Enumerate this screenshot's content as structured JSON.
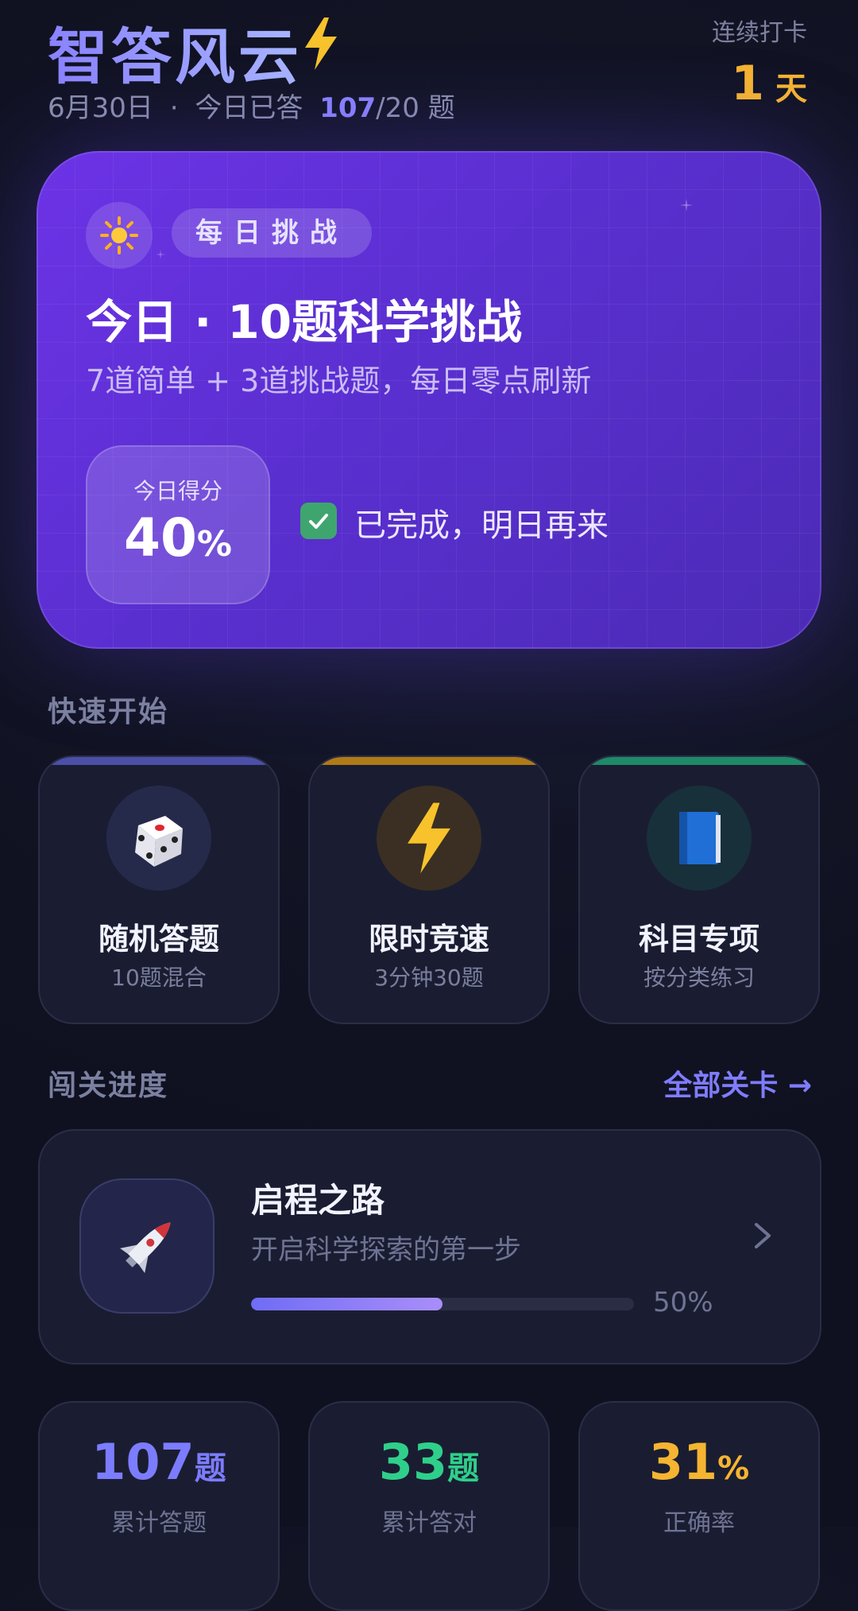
{
  "header": {
    "app_title": "智答风云",
    "date": "6月30日",
    "separator": "·",
    "answered_prefix": "今日已答",
    "answered_count": "107",
    "answered_goal": "/20",
    "answered_unit": "题",
    "streak_label": "连续打卡",
    "streak_days": "1",
    "streak_unit": "天"
  },
  "challenge": {
    "badge": "每日挑战",
    "title": "今日 · 10题科学挑战",
    "subtitle": "7道简单 + 3道挑战题，每日零点刷新",
    "score_label": "今日得分",
    "score_value": "40",
    "score_unit": "%",
    "status_text": "已完成，明日再来"
  },
  "quick_start": {
    "title": "快速开始",
    "tiles": [
      {
        "title": "随机答题",
        "subtitle": "10题混合",
        "icon": "dice-icon",
        "accent": "#4b4fa8"
      },
      {
        "title": "限时竞速",
        "subtitle": "3分钟30题",
        "icon": "lightning-icon",
        "accent": "#b07a16"
      },
      {
        "title": "科目专项",
        "subtitle": "按分类练习",
        "icon": "book-icon",
        "accent": "#1e8a67"
      }
    ]
  },
  "progress": {
    "title": "闯关进度",
    "all_levels": "全部关卡 →",
    "level": {
      "title": "启程之路",
      "subtitle": "开启科学探索的第一步",
      "progress": 0.5,
      "progress_text": "50%"
    }
  },
  "stats": [
    {
      "value": "107",
      "unit": "题",
      "label": "累计答题",
      "color": "#7c7cff"
    },
    {
      "value": "33",
      "unit": "题",
      "label": "累计答对",
      "color": "#2fcf8b"
    },
    {
      "value": "31",
      "unit": "%",
      "label": "正确率",
      "color": "#f5b431"
    }
  ]
}
